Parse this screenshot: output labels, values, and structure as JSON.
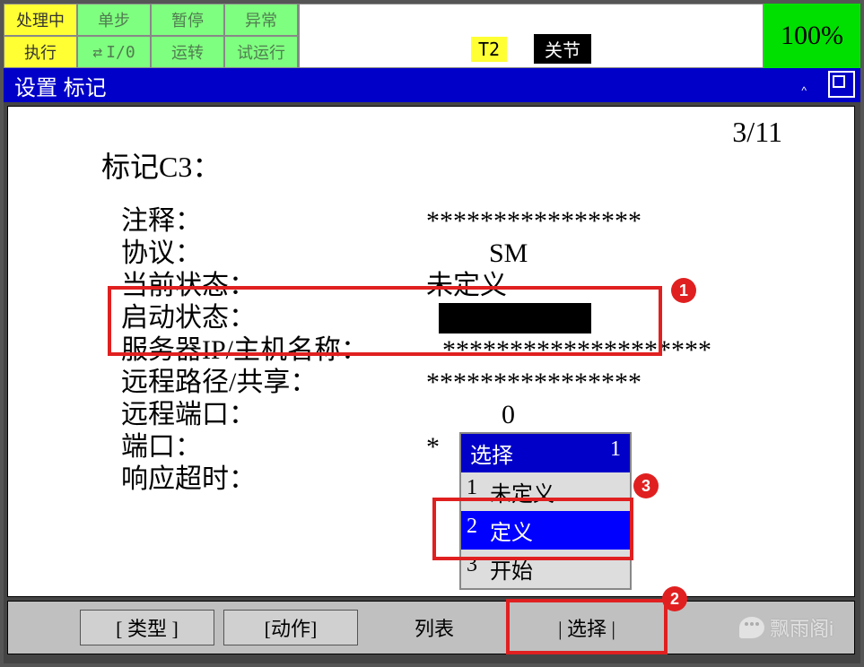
{
  "status_grid": {
    "r1": [
      "处理中",
      "单步",
      "暂停",
      "异常"
    ],
    "r2": [
      "执行",
      "I/0",
      "运转",
      "试运行"
    ]
  },
  "msg": {
    "t2": "T2",
    "joint": "关节"
  },
  "percent": "100%",
  "title": "设置 标记",
  "pager": "3/11",
  "heading": "标记C3：",
  "fields": {
    "comment_label": "注释：",
    "comment_val": "****************",
    "proto_label": "协议：",
    "proto_val": "SM",
    "curstate_label": "当前状态：",
    "curstate_val": "未定义",
    "startstate_label": "启动状态：",
    "server_label": "服务器IP/主机名称：",
    "server_val": "********************",
    "remotepath_label": "远程路径/共享：",
    "remotepath_val": "****************",
    "remoteport_label": "远程端口：",
    "remoteport_val": "0",
    "port_label": "端口：",
    "port_val": "*",
    "timeout_label": "响应超时："
  },
  "dropdown": {
    "header": "选择",
    "header_count": "1",
    "options": [
      {
        "n": "1",
        "t": "未定义"
      },
      {
        "n": "2",
        "t": "定义"
      },
      {
        "n": "3",
        "t": "开始"
      }
    ]
  },
  "footer": {
    "type": "[ 类型 ]",
    "action": "[动作]",
    "list": "列表",
    "select": "| 选择 |"
  },
  "watermark": "飘雨阁i",
  "annotations": {
    "a1": "1",
    "a2": "2",
    "a3": "3"
  }
}
